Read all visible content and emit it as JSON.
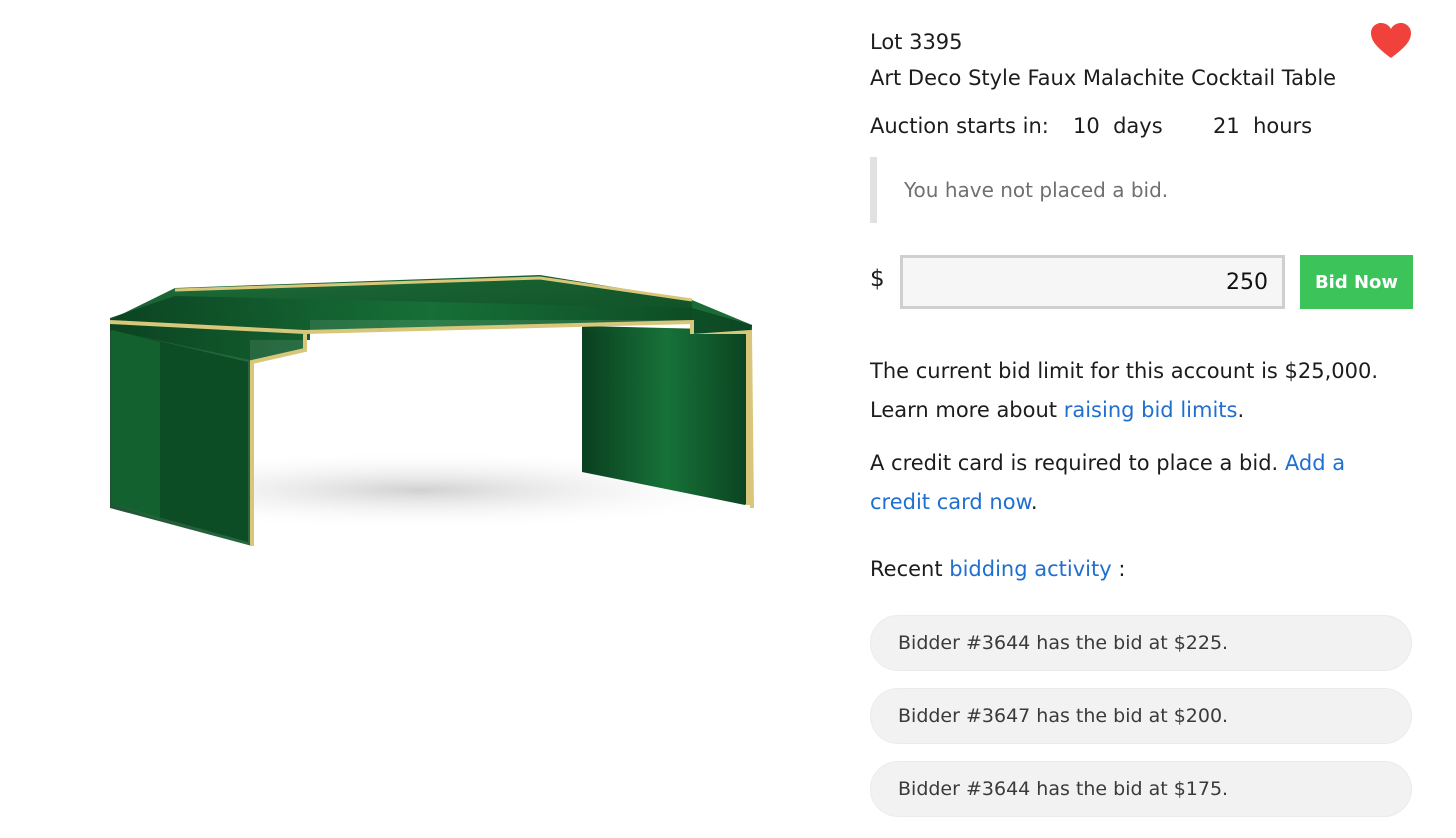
{
  "lot": {
    "number": "Lot 3395",
    "title": "Art Deco Style Faux Malachite Cocktail Table",
    "favorite_icon": "heart-icon",
    "favorite_color": "#f0413b"
  },
  "countdown": {
    "label": "Auction starts in:",
    "days": "10  days",
    "hours": "21  hours"
  },
  "bid_status": "You have not placed a bid.",
  "bid_form": {
    "currency": "$",
    "amount": "250",
    "button_label": "Bid Now",
    "button_color": "#3cc45b"
  },
  "limit_info": {
    "text": "The current bid limit for this account is $25,000.",
    "learn_prefix": "Learn more about ",
    "learn_link": "raising bid limits",
    "learn_suffix": "."
  },
  "card_info": {
    "text": "A credit card is required to place a bid. ",
    "link": "Add a credit card now",
    "suffix": "."
  },
  "recent": {
    "prefix": "Recent ",
    "link": "bidding activity",
    "suffix": " :",
    "items": [
      "Bidder #3644 has the bid at $225.",
      "Bidder #3647 has the bid at $200.",
      "Bidder #3644 has the bid at $175."
    ]
  },
  "colors": {
    "link": "#1f6fd1",
    "table_green": "#0f5a2a",
    "brass_trim": "#d8c77a"
  }
}
